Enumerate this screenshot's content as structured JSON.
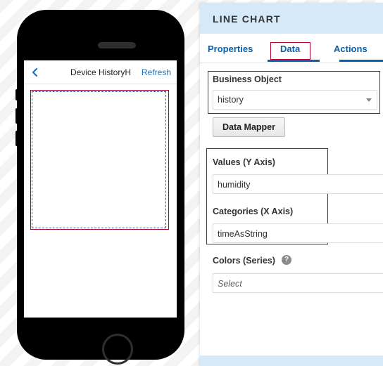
{
  "phone": {
    "header": {
      "title": "Device HistoryH",
      "refresh_label": "Refresh"
    }
  },
  "panel": {
    "title": "LINE CHART",
    "tabs": [
      {
        "label": "Properties"
      },
      {
        "label": "Data",
        "active": true
      },
      {
        "label": "Actions"
      }
    ],
    "business_object": {
      "label": "Business Object",
      "value": "history"
    },
    "data_mapper_label": "Data Mapper",
    "values_axis": {
      "label": "Values (Y Axis)",
      "value": "humidity"
    },
    "categories_axis": {
      "label": "Categories (X Axis)",
      "value": "timeAsString"
    },
    "colors": {
      "label": "Colors (Series)",
      "placeholder": "Select",
      "help_symbol": "?"
    }
  },
  "colors": {
    "accent": "#0c5fa8",
    "header_bg": "#d6e9f8",
    "highlight": "#b3002d"
  }
}
